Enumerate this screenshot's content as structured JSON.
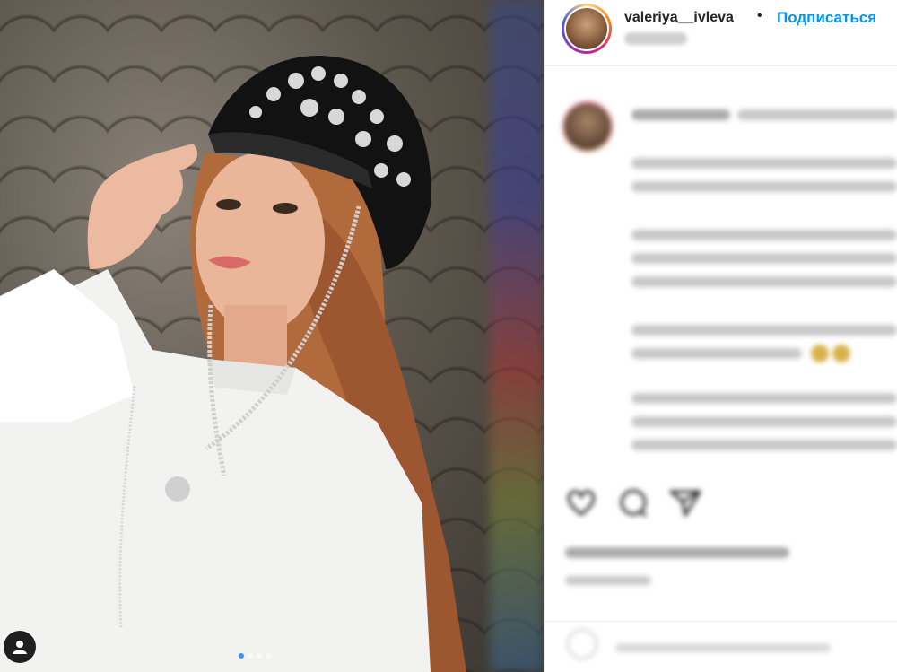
{
  "post": {
    "username": "valeriya__ivleva",
    "separator": "•",
    "follow_label": "Подписаться"
  },
  "carousel": {
    "total": 4,
    "active_index": 0
  },
  "icons": {
    "tag": "user-tag-icon",
    "like": "heart-icon",
    "comment": "comment-icon",
    "share": "share-icon",
    "emoji": "emoji-icon"
  },
  "colors": {
    "follow": "#0095f6",
    "text": "#262626",
    "carousel_active": "#3897f0"
  }
}
